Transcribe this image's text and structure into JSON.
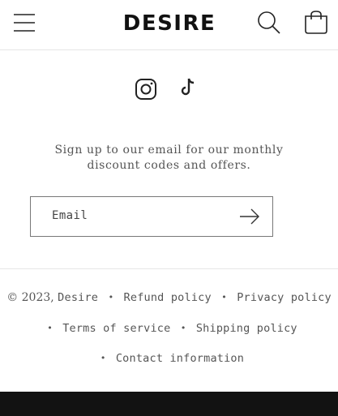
{
  "header": {
    "logo_text": "DESIRE",
    "menu_icon": "hamburger-icon",
    "search_icon": "search-icon",
    "cart_icon": "cart-icon"
  },
  "social": {
    "items": [
      {
        "icon": "instagram-icon",
        "label": "Instagram"
      },
      {
        "icon": "tiktok-icon",
        "label": "TikTok"
      }
    ]
  },
  "newsletter": {
    "text": "Sign up to our email for our monthly discount codes and offers.",
    "email_label": "Email",
    "submit_icon": "arrow-right-icon"
  },
  "footer": {
    "copyright_prefix": "© 2023,",
    "store_name": "Desire",
    "links": [
      "Refund policy",
      "Privacy policy",
      "Terms of service",
      "Shipping policy",
      "Contact information"
    ],
    "separator": "•"
  },
  "colors": {
    "bottom_bar": "#121212",
    "text": "#555555",
    "border": "#777777"
  }
}
